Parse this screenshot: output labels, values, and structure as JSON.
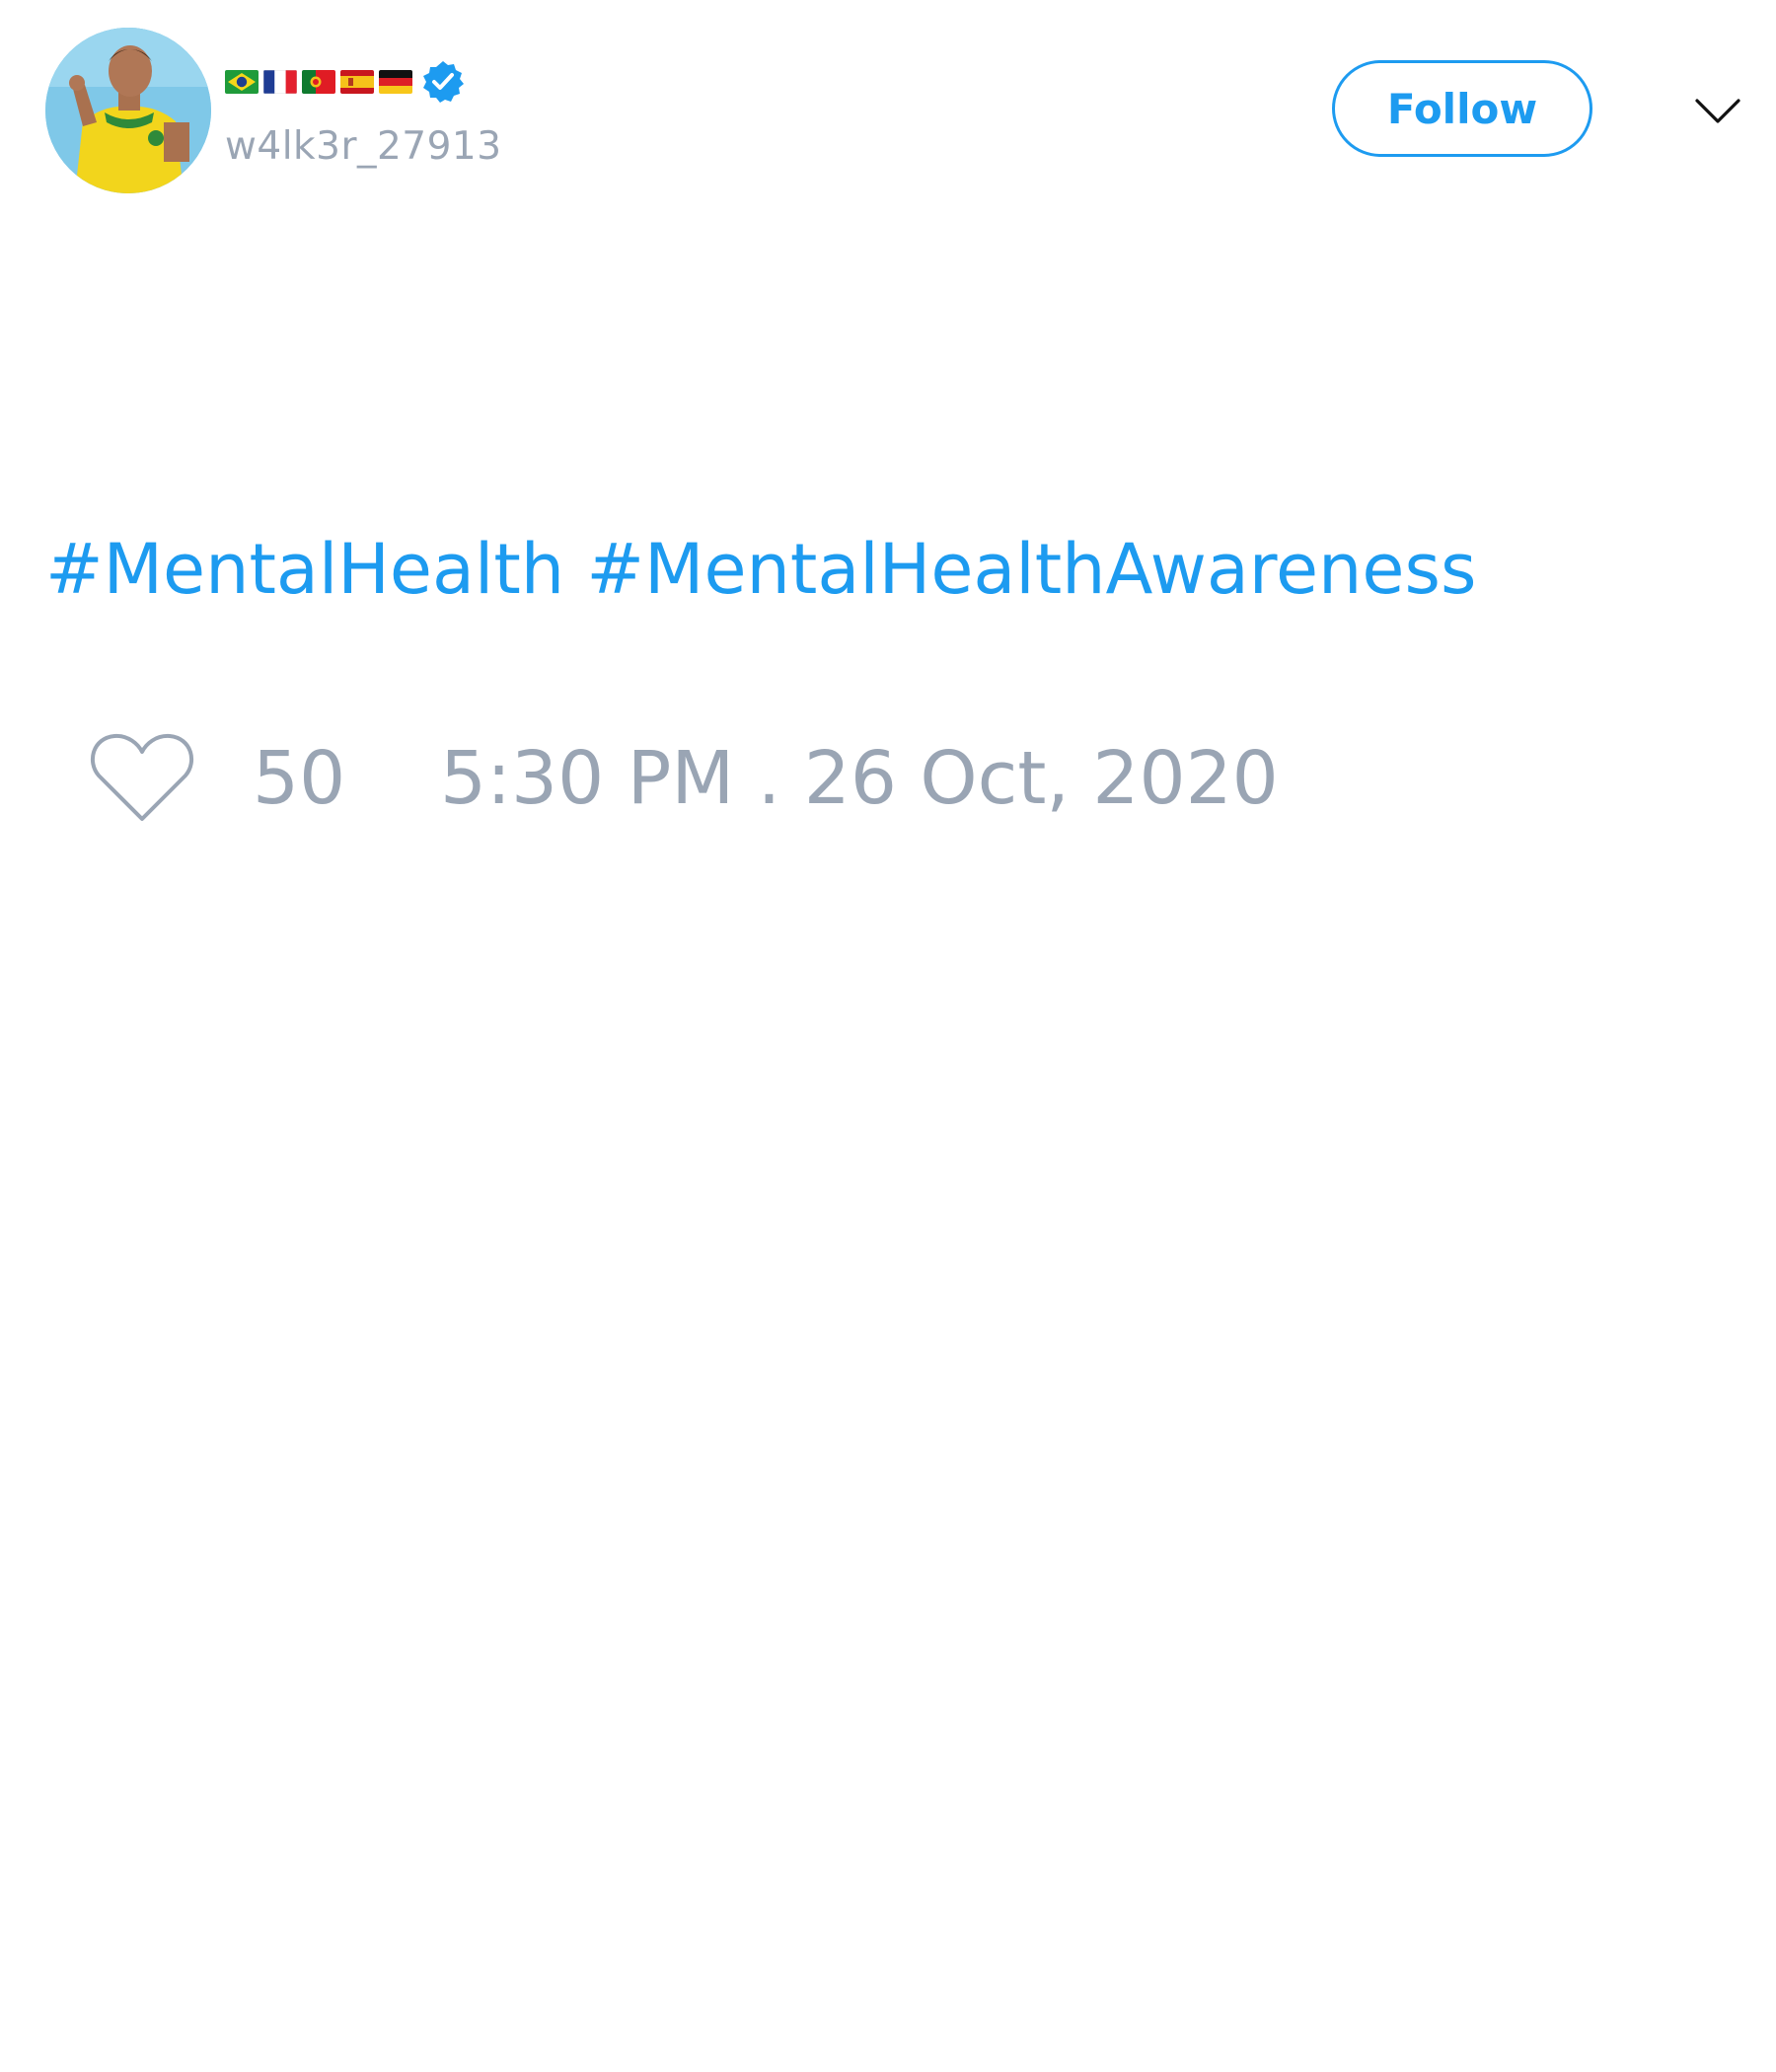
{
  "author": {
    "display_name_flags": [
      "flag-brazil",
      "flag-france",
      "flag-portugal",
      "flag-spain",
      "flag-germany"
    ],
    "verified_icon": "verified-badge-icon",
    "handle": "w4lk3r_27913",
    "avatar_icon": "avatar-photo"
  },
  "header": {
    "follow_label": "Follow",
    "menu_icon": "chevron-down-icon"
  },
  "tweet": {
    "hashtags": [
      "#MentalHealth",
      "#MentalHealthAwareness"
    ]
  },
  "footer": {
    "like_icon": "heart-icon",
    "like_count": "50",
    "timestamp": "5:30 PM . 26 Oct, 2020"
  },
  "colors": {
    "accent": "#1d9bf0",
    "muted": "#9aa5b4"
  }
}
